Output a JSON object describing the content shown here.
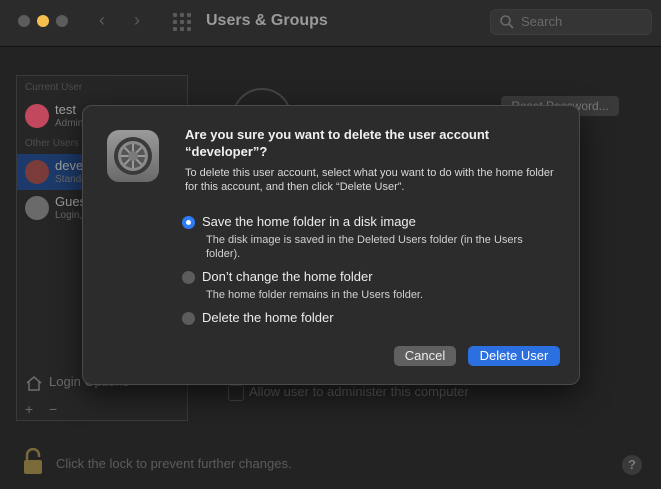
{
  "window": {
    "title": "Users & Groups",
    "search_placeholder": "Search",
    "nav_back": "‹",
    "nav_forward": "›"
  },
  "sidebar": {
    "section_current": "Current User",
    "section_other": "Other Users",
    "users": [
      {
        "name": "test",
        "role": "Admin",
        "avatar_color": "#c2485d"
      },
      {
        "name": "developer",
        "role": "Standard",
        "avatar_color": "#7a3b3b",
        "selected": true
      },
      {
        "name": "Guest User",
        "role": "Login, Sharing",
        "avatar_color": "#6a6a6a"
      }
    ],
    "login_options_label": "Login Options",
    "add_label": "+",
    "remove_label": "−"
  },
  "main": {
    "reset_password_label": "Reset Password...",
    "allow_admin_label": "Allow user to administer this computer"
  },
  "footer": {
    "lock_text": "Click the lock to prevent further changes.",
    "help_label": "?"
  },
  "dialog": {
    "title": "Are you sure you want to delete the user account “developer”?",
    "body": "To delete this user account, select what you want to do with the home folder for this account, and then click “Delete User”.",
    "options": [
      {
        "label": "Save the home folder in a disk image",
        "description": "The disk image is saved in the Deleted Users folder (in the Users folder).",
        "selected": true
      },
      {
        "label": "Don’t change the home folder",
        "description": "The home folder remains in the Users folder.",
        "selected": false
      },
      {
        "label": "Delete the home folder",
        "description": "",
        "selected": false
      }
    ],
    "cancel_label": "Cancel",
    "delete_label": "Delete User"
  },
  "colors": {
    "accent": "#2b6fe0",
    "radio_selected": "#2e7cf6",
    "traffic_yellow": "#f5be4f"
  }
}
